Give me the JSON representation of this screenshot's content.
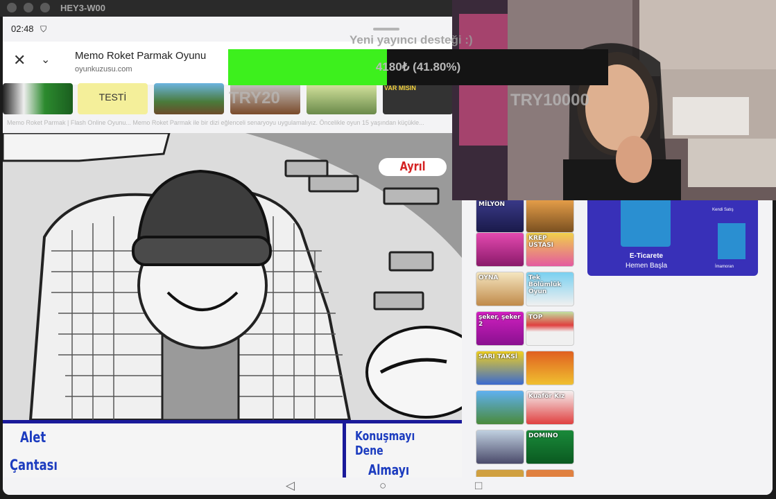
{
  "window": {
    "title": "HEY3-W00"
  },
  "status": {
    "time": "02:48"
  },
  "browser_sheet": {
    "title": "Memo Roket Parmak Oyunu",
    "url": "oyunkuzusu.com",
    "description": "Memo Roket Parmak | Flash Online Oyunu... Memo Roket Parmak ile bir dizi eğlenceli senaryoyu uygulamalıyız. Öncelikle oyun 15 yaşından küçükle..."
  },
  "thumbnails": [
    {
      "label": ""
    },
    {
      "label": "TESTİ"
    },
    {
      "label": ""
    },
    {
      "label": ""
    },
    {
      "label": ""
    },
    {
      "label": "VAR MISIN"
    }
  ],
  "game": {
    "exit_button": "Ayrıl",
    "tool_bag_line1": "Alet",
    "tool_bag_line2": "Çantası",
    "try_talk": "Konuşmayı Dene",
    "try_take": "Almayı Dene"
  },
  "side_games": [
    {
      "label": "MİLYON"
    },
    {
      "label": ""
    },
    {
      "label": ""
    },
    {
      "label": "KREP USTASI"
    },
    {
      "label": "OYNA"
    },
    {
      "label": "Tek Bölümlük Oyun"
    },
    {
      "label": "şeker, şeker 2"
    },
    {
      "label": "TOP"
    },
    {
      "label": "SARI TAKSİ"
    },
    {
      "label": ""
    },
    {
      "label": ""
    },
    {
      "label": "Kuaför Kız"
    },
    {
      "label": ""
    },
    {
      "label": "DOMINO"
    }
  ],
  "ad": {
    "line1": "E-Ticarete",
    "line2": "Hemen Başla",
    "small1": "Kendi Satış",
    "small2": "İmamoran"
  },
  "overlay": {
    "donation_title": "Yeni yayıncı desteği :)",
    "goal_text": "4180₺ (41.80%)",
    "goal_fraction": 0.418,
    "try_low": "TRY20",
    "try_high": "TRY10000"
  },
  "colors": {
    "goal_fill": "#3df01d",
    "game_blue": "#1c3cbf",
    "exit_red": "#d42222"
  }
}
